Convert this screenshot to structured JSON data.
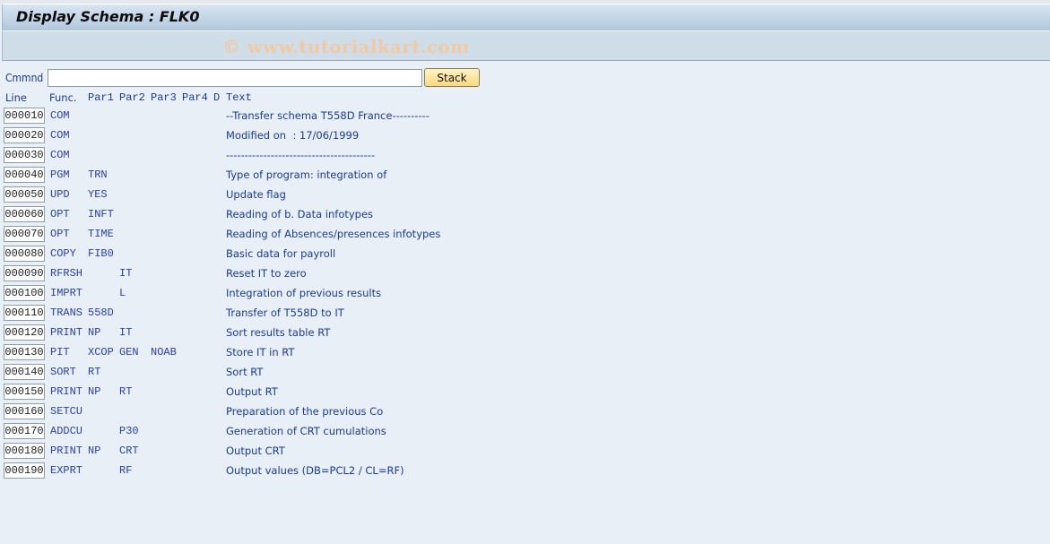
{
  "window": {
    "title": "Display Schema : FLK0",
    "watermark": "© www.tutorialkart.com"
  },
  "command": {
    "label": "Cmmnd",
    "value": "",
    "placeholder": "",
    "stack_button_label": "Stack"
  },
  "table": {
    "headers": {
      "line": "Line",
      "func": "Func.",
      "par1": "Par1",
      "par2": "Par2",
      "par3": "Par3",
      "par4": "Par4",
      "d": "D",
      "text": "Text"
    },
    "rows": [
      {
        "line": "000010",
        "func": "COM",
        "par1": "",
        "par2": "",
        "par3": "",
        "par4": "",
        "d": "",
        "text": "--Transfer schema T558D France----------"
      },
      {
        "line": "000020",
        "func": "COM",
        "par1": "",
        "par2": "",
        "par3": "",
        "par4": "",
        "d": "",
        "text": "Modified on  : 17/06/1999"
      },
      {
        "line": "000030",
        "func": "COM",
        "par1": "",
        "par2": "",
        "par3": "",
        "par4": "",
        "d": "",
        "text": "----------------------------------------"
      },
      {
        "line": "000040",
        "func": "PGM",
        "par1": "TRN",
        "par2": "",
        "par3": "",
        "par4": "",
        "d": "",
        "text": "Type of program: integration of"
      },
      {
        "line": "000050",
        "func": "UPD",
        "par1": "YES",
        "par2": "",
        "par3": "",
        "par4": "",
        "d": "",
        "text": "Update flag"
      },
      {
        "line": "000060",
        "func": "OPT",
        "par1": "INFT",
        "par2": "",
        "par3": "",
        "par4": "",
        "d": "",
        "text": "Reading of b. Data infotypes"
      },
      {
        "line": "000070",
        "func": "OPT",
        "par1": "TIME",
        "par2": "",
        "par3": "",
        "par4": "",
        "d": "",
        "text": "Reading of Absences/presences infotypes"
      },
      {
        "line": "000080",
        "func": "COPY",
        "par1": "FIB0",
        "par2": "",
        "par3": "",
        "par4": "",
        "d": "",
        "text": "Basic data for payroll"
      },
      {
        "line": "000090",
        "func": "RFRSH",
        "par1": "",
        "par2": "IT",
        "par3": "",
        "par4": "",
        "d": "",
        "text": "Reset IT to zero"
      },
      {
        "line": "000100",
        "func": "IMPRT",
        "par1": "",
        "par2": "L",
        "par3": "",
        "par4": "",
        "d": "",
        "text": "Integration of previous results"
      },
      {
        "line": "000110",
        "func": "TRANS",
        "par1": "558D",
        "par2": "",
        "par3": "",
        "par4": "",
        "d": "",
        "text": "Transfer of T558D to IT"
      },
      {
        "line": "000120",
        "func": "PRINT",
        "par1": "NP",
        "par2": "IT",
        "par3": "",
        "par4": "",
        "d": "",
        "text": "Sort results table RT"
      },
      {
        "line": "000130",
        "func": "PIT",
        "par1": "XCOP",
        "par2": "GEN",
        "par3": "NOAB",
        "par4": "",
        "d": "",
        "text": "Store IT in RT"
      },
      {
        "line": "000140",
        "func": "SORT",
        "par1": "RT",
        "par2": "",
        "par3": "",
        "par4": "",
        "d": "",
        "text": "Sort RT"
      },
      {
        "line": "000150",
        "func": "PRINT",
        "par1": "NP",
        "par2": "RT",
        "par3": "",
        "par4": "",
        "d": "",
        "text": "Output RT"
      },
      {
        "line": "000160",
        "func": "SETCU",
        "par1": "",
        "par2": "",
        "par3": "",
        "par4": "",
        "d": "",
        "text": "Preparation of the previous Co"
      },
      {
        "line": "000170",
        "func": "ADDCU",
        "par1": "",
        "par2": "P30",
        "par3": "",
        "par4": "",
        "d": "",
        "text": "Generation of CRT cumulations"
      },
      {
        "line": "000180",
        "func": "PRINT",
        "par1": "NP",
        "par2": "CRT",
        "par3": "",
        "par4": "",
        "d": "",
        "text": "Output CRT"
      },
      {
        "line": "000190",
        "func": "EXPRT",
        "par1": "",
        "par2": "RF",
        "par3": "",
        "par4": "",
        "d": "",
        "text": "Output values (DB=PCL2 / CL=RF)"
      }
    ]
  }
}
